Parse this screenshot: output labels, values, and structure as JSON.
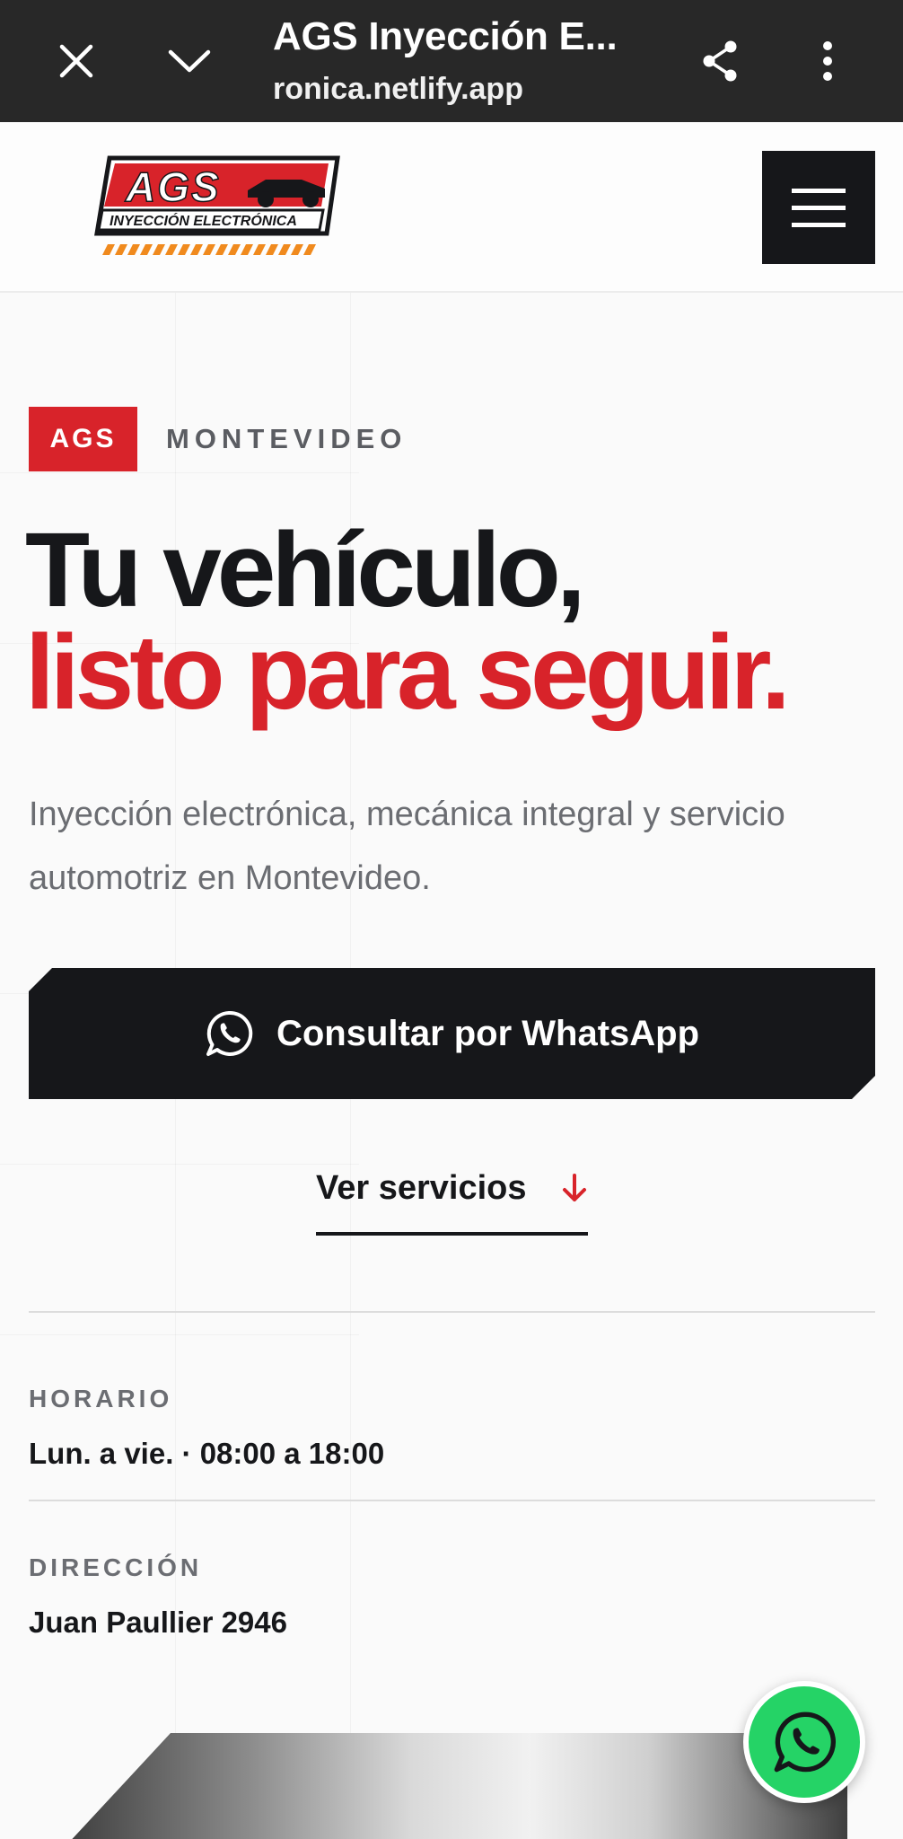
{
  "browser": {
    "title": "AGS Inyección E...",
    "url": "ronica.netlify.app",
    "icons": [
      "close-icon",
      "chevron-down-icon",
      "share-icon",
      "more-vert-icon"
    ]
  },
  "header": {
    "logo_text": "AGS",
    "logo_subtext": "INYECCIÓN ELECTRÓNICA",
    "menu_icon": "hamburger-icon"
  },
  "hero": {
    "tag": "AGS",
    "city": "MONTEVIDEO",
    "headline_line1": "Tu vehículo,",
    "headline_line2": "listo para seguir.",
    "lead": "Inyección electrónica, mecánica integral y servicio automotriz en Montevideo.",
    "cta_label": "Consultar por WhatsApp",
    "services_label": "Ver servicios"
  },
  "info": {
    "hours_label": "HORARIO",
    "hours_value": "Lun. a vie. · 08:00 a 18:00",
    "address_label": "DIRECCIÓN",
    "address_value": "Juan Paullier 2946"
  },
  "colors": {
    "accent": "#d8232a",
    "dark": "#16171a",
    "whatsapp": "#25d366",
    "browser_bar": "#282828"
  }
}
